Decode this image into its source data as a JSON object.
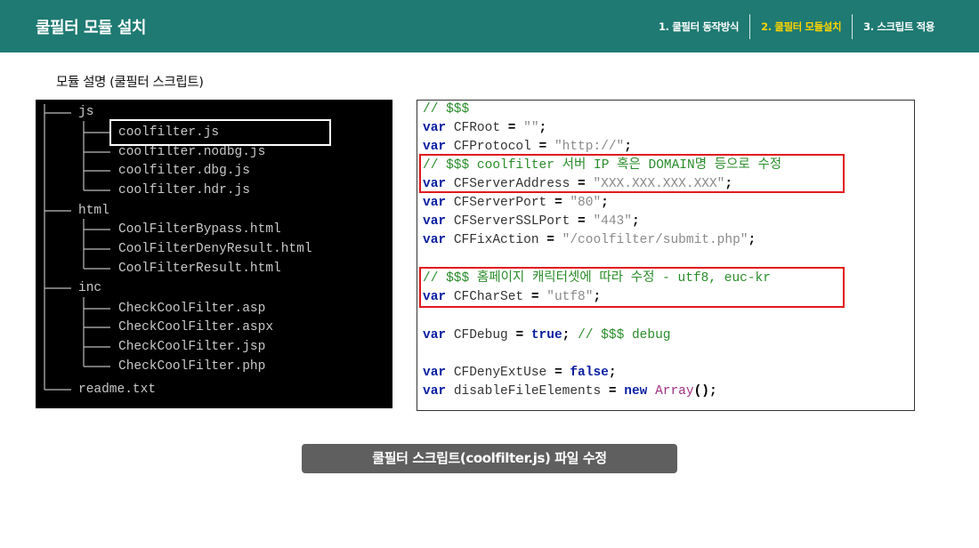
{
  "header": {
    "title": "쿨필터 모듈 설치",
    "nav": [
      {
        "label": "1. 쿨필터 동작방식",
        "active": false
      },
      {
        "label": "2. 쿨필터 모듈설치",
        "active": true
      },
      {
        "label": "3. 스크립트 적용",
        "active": false
      }
    ]
  },
  "section_label": "모듈 설명 (쿨필터 스크립트)",
  "tree": {
    "lines": [
      "js",
      "coolfilter.js",
      "coolfilter.nodbg.js",
      "coolfilter.dbg.js",
      "coolfilter.hdr.js",
      "html",
      "CoolFilterBypass.html",
      "CoolFilterDenyResult.html",
      "CoolFilterResult.html",
      "inc",
      "CheckCoolFilter.asp",
      "CheckCoolFilter.aspx",
      "CheckCoolFilter.jsp",
      "CheckCoolFilter.php",
      "readme.txt"
    ]
  },
  "code": {
    "line0": "// $$$",
    "kw": "var",
    "root_name": "CFRoot",
    "root_val": "\"\"",
    "protocol_name": "CFProtocol",
    "protocol_val": "\"http://\"",
    "comment_server": "// $$$ coolfilter 서버 IP 혹은 DOMAIN명 등으로 수정",
    "server_name": "CFServerAddress",
    "server_val": "\"XXX.XXX.XXX.XXX\"",
    "port_name": "CFServerPort",
    "port_val": "\"80\"",
    "sslport_name": "CFServerSSLPort",
    "sslport_val": "\"443\"",
    "fix_name": "CFFixAction",
    "fix_val": "\"/coolfilter/submit.php\"",
    "comment_charset": "// $$$ 홈페이지 캐릭터셋에 따라 수정 - utf8, euc-kr",
    "charset_name": "CFCharSet",
    "charset_val": "\"utf8\"",
    "debug_name": "CFDebug",
    "debug_val": "true",
    "debug_comment": "// $$$ debug",
    "deny_name": "CFDenyExtUse",
    "deny_val": "false",
    "disable_name": "disableFileElements",
    "new_kw": "new",
    "array_kw": "Array",
    "paren": "()",
    "eq": "=",
    "semi": ";"
  },
  "caption": "쿨필터 스크립트(coolfilter.js) 파일 수정",
  "colors": {
    "header_bg": "#1e7a72",
    "nav_active": "#ffd400",
    "highlight_red": "#e0191e",
    "caption_bg": "#5f5f5f"
  }
}
